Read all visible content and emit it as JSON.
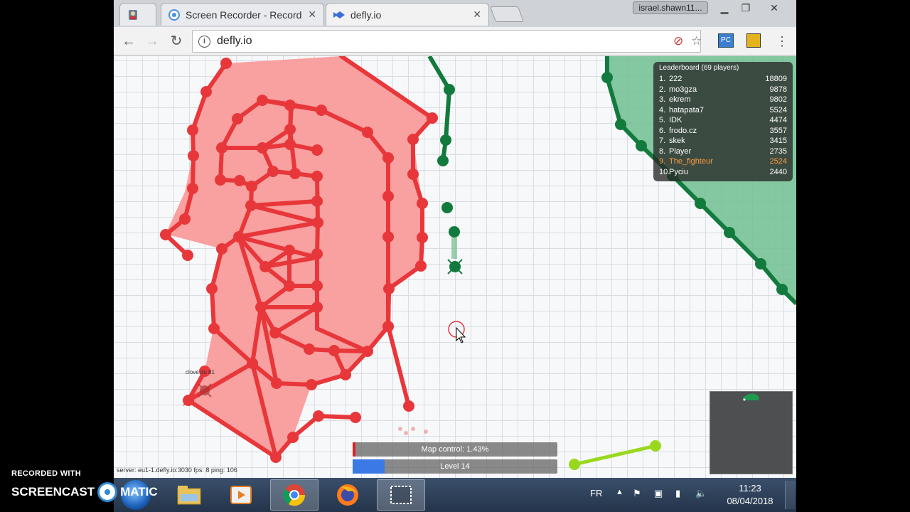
{
  "browser": {
    "tabs": [
      {
        "title": "",
        "icon": "person-icon"
      },
      {
        "title": "Screen Recorder - Record",
        "icon": "recorder-icon"
      },
      {
        "title": "defly.io",
        "icon": "defly-icon"
      }
    ],
    "profile_name": "israel.shawn11...",
    "url": "defly.io"
  },
  "game": {
    "leaderboard": {
      "title": "Leaderboard (69 players)",
      "entries": [
        {
          "rank": "1.",
          "name": "222",
          "score": "18809"
        },
        {
          "rank": "2.",
          "name": "mo3gza",
          "score": "9878"
        },
        {
          "rank": "3.",
          "name": "ekrem",
          "score": "9802"
        },
        {
          "rank": "4.",
          "name": "hatapata7",
          "score": "5524"
        },
        {
          "rank": "5.",
          "name": "IDK",
          "score": "4474"
        },
        {
          "rank": "6.",
          "name": "frodo.cz",
          "score": "3557"
        },
        {
          "rank": "7.",
          "name": "skek",
          "score": "3415"
        },
        {
          "rank": "8.",
          "name": "Player",
          "score": "2735"
        },
        {
          "rank": "9.",
          "name": "The_fighteur",
          "score": "2524",
          "highlight": true
        },
        {
          "rank": "10.",
          "name": "Pyciu",
          "score": "2440"
        }
      ]
    },
    "map_control": {
      "label": "Map control: 1.43%",
      "value": 0.0143
    },
    "level": {
      "label": "Level 14",
      "progress": 0.16
    },
    "server_info": "server: eu1-1.defly.io:3030 fps: 8 ping: 106",
    "player_tag": "clove du 81",
    "colors": {
      "red_team": "#e8373a",
      "red_fill": "#f9a0a0",
      "green_team": "#137a3d",
      "green_fill": "#6fbf8f",
      "lime": "#9ad81e",
      "highlight": "#ff9a3c"
    }
  },
  "taskbar": {
    "apps": [
      "start-orb",
      "file-explorer-icon",
      "media-player-icon",
      "chrome-icon",
      "firefox-icon",
      "snipping-tool-icon"
    ],
    "language": "FR",
    "time": "11:23",
    "date": "08/04/2018"
  },
  "watermark": {
    "line1": "RECORDED WITH",
    "line2a": "SCREENCAST",
    "line2b": "MATIC"
  }
}
